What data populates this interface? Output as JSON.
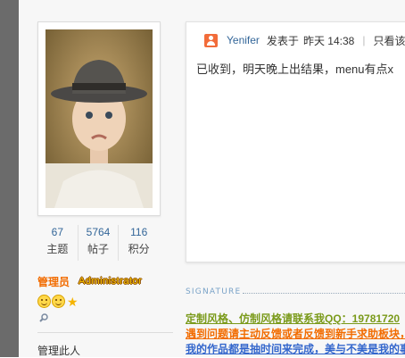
{
  "profile": {
    "stats": [
      {
        "value": "67",
        "label": "主题"
      },
      {
        "value": "5764",
        "label": "帖子"
      },
      {
        "value": "116",
        "label": "积分"
      }
    ],
    "role_name": "管理员",
    "role_title": "Administrator",
    "medals": [
      "smiley-medal-icon",
      "smiley-medal-icon",
      "star-icon"
    ],
    "manage_link": "管理此人"
  },
  "post": {
    "author": "Yenifer",
    "posted_label": "发表于",
    "time": "昨天 14:38",
    "separator": "|",
    "view_only": "只看该",
    "body": "已收到，明天晚上出结果，menu有点x"
  },
  "signature": {
    "label": "SIGNATURE",
    "lines": [
      "定制风格、仿制风格请联系我QQ：19781720",
      "遇到问题请主动反馈或者反馈到新手求助板块，",
      "我的作品都是抽时间来完成，美与不美是我的事"
    ]
  },
  "colors": {
    "link": "#336699",
    "role": "#f26c00",
    "sig1": "#7a9a1a",
    "sig2": "#f26c00",
    "sig3": "#3366cc"
  }
}
